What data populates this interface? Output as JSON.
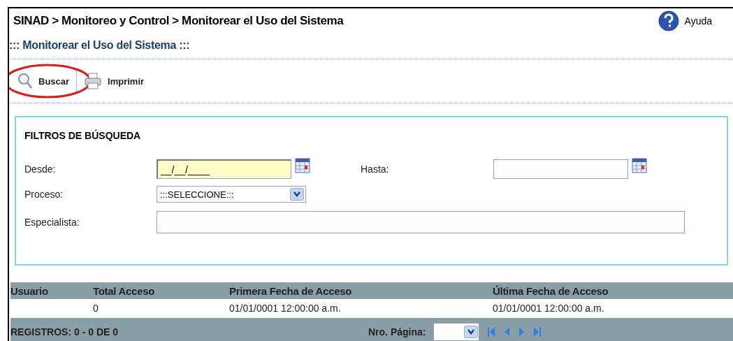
{
  "breadcrumb": "SINAD > Monitoreo y Control > Monitorear el Uso del Sistema",
  "help": {
    "label": "Ayuda"
  },
  "page_title": "::: Monitorear el Uso del Sistema :::",
  "toolbar": [
    {
      "kind": "search",
      "label": "Buscar",
      "highlighted": true
    },
    {
      "kind": "print",
      "label": "Imprimir",
      "highlighted": false
    }
  ],
  "filters": {
    "title": "FILTROS DE BÚSQUEDA",
    "desde": {
      "label": "Desde:",
      "value": "__/__/____",
      "focused": true
    },
    "hasta": {
      "label": "Hasta:",
      "focused": false
    },
    "proceso": {
      "label": "Proceso:",
      "value": ":::SELECCIONE:::"
    },
    "especialista": {
      "label": "Especialista:"
    }
  },
  "table": {
    "columns": [
      "Usuario",
      "Total Acceso",
      "Primera Fecha de Acceso",
      "Última Fecha de Acceso"
    ],
    "rows": [
      {
        "cells": [
          null,
          "0",
          "01/01/0001 12:00:00 a.m.",
          "01/01/0001 12:00:00 a.m."
        ]
      }
    ]
  },
  "footer": {
    "records": "REGISTROS: 0 - 0 DE 0",
    "page_label": "Nro. Página:"
  }
}
